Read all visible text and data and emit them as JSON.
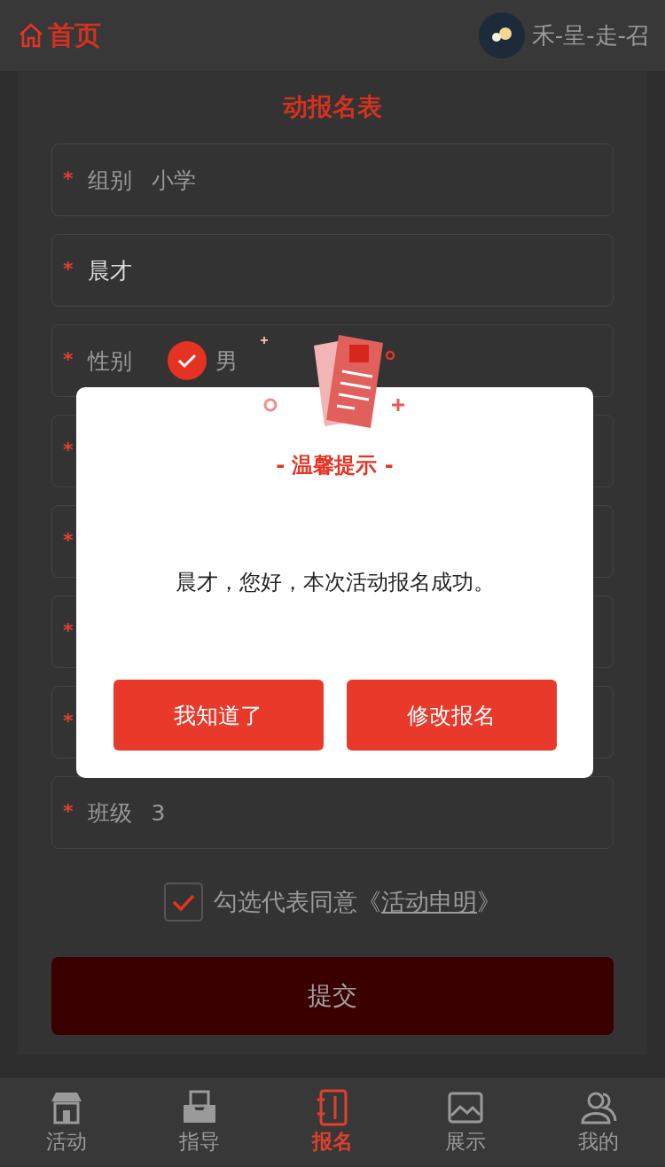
{
  "header": {
    "home_label": "首页",
    "user_name": "禾-呈-走-召"
  },
  "form": {
    "title": "动报名表",
    "fields": [
      {
        "kind": "select",
        "mark": "*",
        "label": "组别",
        "value": "小学"
      },
      {
        "kind": "input",
        "mark": "*",
        "value": "晨才"
      },
      {
        "kind": "radio",
        "mark": "*",
        "label": "性别",
        "options": [
          {
            "label": "男",
            "selected": true
          }
        ]
      },
      {
        "kind": "covered",
        "mark": "*"
      },
      {
        "kind": "covered",
        "mark": "*"
      },
      {
        "kind": "covered",
        "mark": "*"
      },
      {
        "kind": "covered",
        "mark": "*"
      },
      {
        "kind": "select",
        "mark": "*",
        "label": "班级",
        "value": "3"
      }
    ],
    "agreement": {
      "checked": true,
      "text": "勾选代表同意《",
      "link": "活动申明",
      "tail": "》"
    },
    "submit": "提交"
  },
  "tabs": [
    {
      "label": "活动",
      "selected": false
    },
    {
      "label": "指导",
      "selected": false
    },
    {
      "label": "报名",
      "selected": true
    },
    {
      "label": "展示",
      "selected": false
    },
    {
      "label": "我的",
      "selected": false
    }
  ],
  "dialog": {
    "title": "- 温馨提示 -",
    "message": "晨才，您好，本次活动报名成功。",
    "buttons": [
      "我知道了",
      "修改报名"
    ]
  }
}
